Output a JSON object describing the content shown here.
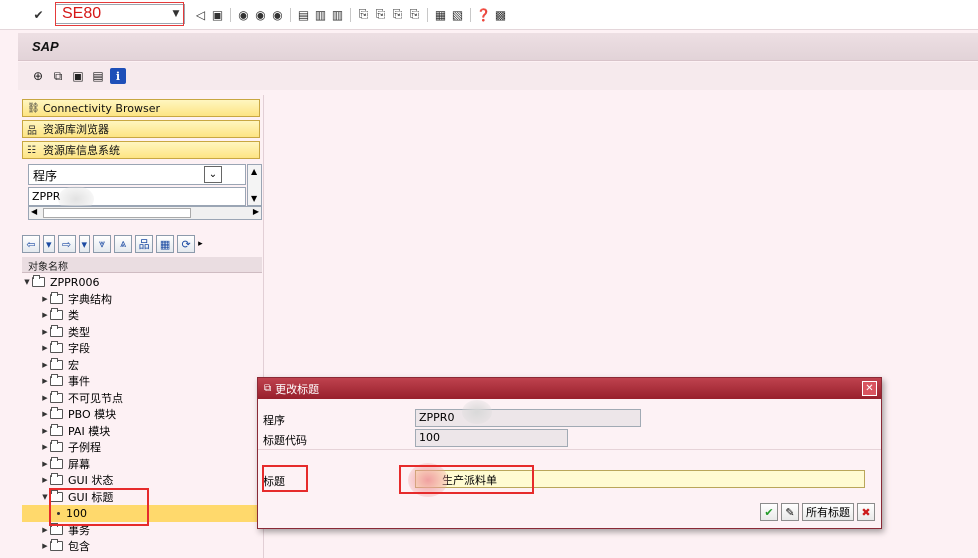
{
  "system_toolbar": {
    "command_value": "SE80",
    "icons": [
      "check-icon",
      "back-icon",
      "save-icon",
      "back-nav-icon",
      "exit-icon",
      "cancel-icon",
      "print-icon",
      "find-icon",
      "find-next-icon",
      "first-page-icon",
      "prev-page-icon",
      "next-page-icon",
      "last-page-icon",
      "new-session-icon",
      "shortcut-icon",
      "help-icon",
      "layout-icon"
    ]
  },
  "title_bar": {
    "title": "SAP"
  },
  "nav": {
    "buttons": [
      "Connectivity Browser",
      "资源库浏览器",
      "资源库信息系统"
    ],
    "object_type": "程序",
    "object_name": "ZPPR"
  },
  "tree": {
    "column_header": "对象名称",
    "root": "ZPPR006",
    "items": [
      "字典结构",
      "类",
      "类型",
      "字段",
      "宏",
      "事件",
      "不可见节点",
      "PBO 模块",
      "PAI 模块",
      "子例程",
      "屏幕",
      "GUI 状态",
      "GUI 标题",
      "100",
      "事务",
      "包含"
    ]
  },
  "dialog": {
    "title": "更改标题",
    "program_label": "程序",
    "program_value": "ZPPR0",
    "title_code_label": "标题代码",
    "title_code_value": "100",
    "title_label": "标题",
    "title_value": "生产派料单",
    "all_titles_button": "所有标题"
  },
  "colors": {
    "accent_red": "#e62b2b",
    "dialog_title_bar": "#a52a35",
    "selected_row": "#ffd96c",
    "nav_button": "#fde483"
  }
}
